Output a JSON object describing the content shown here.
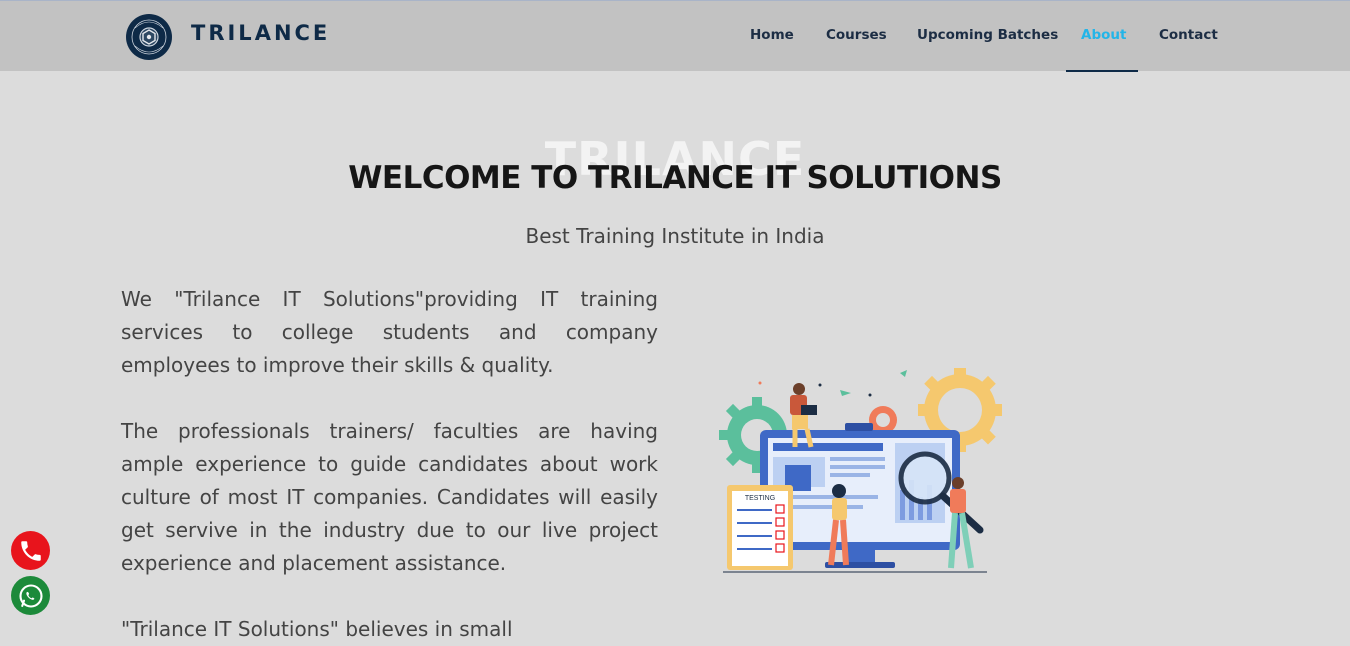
{
  "header": {
    "brand": "TRILANCE",
    "logo_text": "TRILANCE",
    "nav": [
      {
        "label": "Home"
      },
      {
        "label": "Courses"
      },
      {
        "label": "Upcoming Batches"
      },
      {
        "label": "About",
        "active": true
      },
      {
        "label": "Contact"
      }
    ]
  },
  "hero": {
    "ghost_title": "TRILANCE",
    "title": "WELCOME TO TRILANCE IT SOLUTIONS",
    "subtitle": "Best Training Institute in India"
  },
  "content": {
    "paragraphs": [
      "We \"Trilance IT Solutions\"providing IT training services to college students and company employees to improve their skills & quality.",
      "The professionals trainers/ faculties are having ample experience to guide candidates about work culture of most IT companies. Candidates will easily get servive in the industry due to our live project experience and placement assistance.",
      "\"Trilance IT Solutions\" believes in small"
    ]
  },
  "illustration": {
    "clipboard_label": "TESTING"
  },
  "floating": {
    "call_icon": "phone-icon",
    "whatsapp_icon": "whatsapp-icon"
  },
  "colors": {
    "header_bg": "#c2c2c2",
    "page_bg": "#dcdcdc",
    "nav_text": "#1c2d44",
    "nav_active": "#23b5e8",
    "brand": "#0e2a47",
    "call": "#e8141c",
    "whatsapp": "#1c8a3a"
  }
}
